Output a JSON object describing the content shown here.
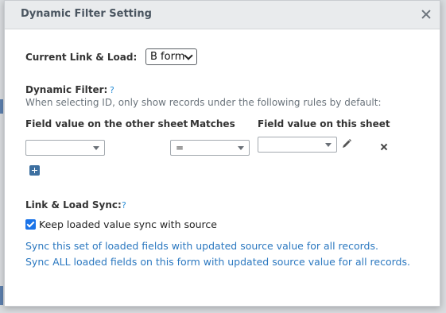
{
  "dialog": {
    "title": "Dynamic Filter Setting",
    "close_icon": "close-icon"
  },
  "link_load": {
    "label": "Current Link & Load:",
    "selected_form": "B form"
  },
  "dynamic_filter": {
    "label": "Dynamic Filter:",
    "help": "?",
    "description": "When selecting ID, only show records under the following rules by default:",
    "columns": [
      "Field value on the other sheet",
      "Matches",
      "Field value on this sheet"
    ],
    "rule": {
      "other_field": "",
      "match_operator": "=",
      "this_field": ""
    },
    "edit_icon": "pencil-icon",
    "remove_icon": "close-icon",
    "add_icon": "plus-icon"
  },
  "sync": {
    "label": "Link & Load Sync:",
    "help": "?",
    "checkbox_label": "Keep loaded value sync with source",
    "checked": true,
    "links": [
      "Sync this set of loaded fields with updated source value for all records.",
      "Sync ALL loaded fields on this form with updated source value for all records."
    ]
  }
}
